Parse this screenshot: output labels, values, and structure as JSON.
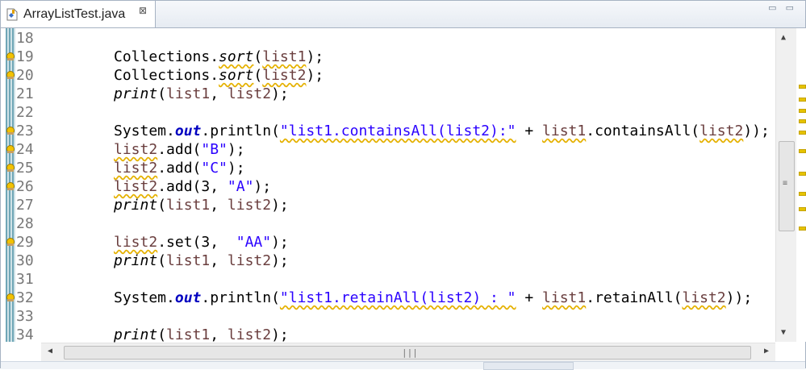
{
  "tab": {
    "filename": "ArrayListTest.java",
    "close_glyph": "⊠"
  },
  "window_buttons": "▭ ▭",
  "lines": [
    {
      "n": "18",
      "warn": false,
      "code": []
    },
    {
      "n": "19",
      "warn": true,
      "code": [
        [
          "Collections.",
          ""
        ],
        [
          "sort",
          "it"
        ],
        [
          "(",
          ""
        ],
        [
          "list1",
          "var"
        ],
        [
          ");",
          ""
        ]
      ]
    },
    {
      "n": "20",
      "warn": true,
      "code": [
        [
          "Collections.",
          ""
        ],
        [
          "sort",
          "it"
        ],
        [
          "(",
          ""
        ],
        [
          "list2",
          "var"
        ],
        [
          ");",
          ""
        ]
      ]
    },
    {
      "n": "21",
      "warn": false,
      "code": [
        [
          "print",
          "it"
        ],
        [
          "(",
          ""
        ],
        [
          "list1",
          "var"
        ],
        [
          ", ",
          ""
        ],
        [
          "list2",
          "var"
        ],
        [
          ");",
          ""
        ]
      ]
    },
    {
      "n": "22",
      "warn": false,
      "code": []
    },
    {
      "n": "23",
      "warn": true,
      "code": [
        [
          "System.",
          ""
        ],
        [
          "out",
          "fld"
        ],
        [
          ".println(",
          ""
        ],
        [
          "\"list1.containsAll(list2):\"",
          "str"
        ],
        [
          " + ",
          ""
        ],
        [
          "list1",
          "var"
        ],
        [
          ".containsAll(",
          ""
        ],
        [
          "list2",
          "var"
        ],
        [
          "));",
          ""
        ]
      ]
    },
    {
      "n": "24",
      "warn": true,
      "code": [
        [
          "list2",
          "var"
        ],
        [
          ".add(",
          ""
        ],
        [
          "\"B\"",
          "str"
        ],
        [
          ");",
          ""
        ]
      ]
    },
    {
      "n": "25",
      "warn": true,
      "code": [
        [
          "list2",
          "var"
        ],
        [
          ".add(",
          ""
        ],
        [
          "\"C\"",
          "str"
        ],
        [
          ");",
          ""
        ]
      ]
    },
    {
      "n": "26",
      "warn": true,
      "code": [
        [
          "list2",
          "var"
        ],
        [
          ".add(3, ",
          ""
        ],
        [
          "\"A\"",
          "str"
        ],
        [
          ");",
          ""
        ]
      ]
    },
    {
      "n": "27",
      "warn": false,
      "code": [
        [
          "print",
          "it"
        ],
        [
          "(",
          ""
        ],
        [
          "list1",
          "var"
        ],
        [
          ", ",
          ""
        ],
        [
          "list2",
          "var"
        ],
        [
          ");",
          ""
        ]
      ]
    },
    {
      "n": "28",
      "warn": false,
      "code": []
    },
    {
      "n": "29",
      "warn": true,
      "code": [
        [
          "list2",
          "var"
        ],
        [
          ".set(3,  ",
          ""
        ],
        [
          "\"AA\"",
          "str"
        ],
        [
          ");",
          ""
        ]
      ]
    },
    {
      "n": "30",
      "warn": false,
      "code": [
        [
          "print",
          "it"
        ],
        [
          "(",
          ""
        ],
        [
          "list1",
          "var"
        ],
        [
          ", ",
          ""
        ],
        [
          "list2",
          "var"
        ],
        [
          ");",
          ""
        ]
      ]
    },
    {
      "n": "31",
      "warn": false,
      "code": []
    },
    {
      "n": "32",
      "warn": true,
      "code": [
        [
          "System.",
          ""
        ],
        [
          "out",
          "fld"
        ],
        [
          ".println(",
          ""
        ],
        [
          "\"list1.retainAll(list2) : \"",
          "str"
        ],
        [
          " + ",
          ""
        ],
        [
          "list1",
          "var"
        ],
        [
          ".retainAll(",
          ""
        ],
        [
          "list2",
          "var"
        ],
        [
          "));",
          ""
        ]
      ]
    },
    {
      "n": "33",
      "warn": false,
      "code": []
    },
    {
      "n": "34",
      "warn": false,
      "code": [
        [
          "print",
          "it"
        ],
        [
          "(",
          ""
        ],
        [
          "list1",
          "var"
        ],
        [
          ", ",
          ""
        ],
        [
          "list2",
          "var"
        ],
        [
          ");",
          ""
        ]
      ]
    }
  ],
  "icons": {
    "file": "java-file-icon",
    "warning": "warning-marker-icon",
    "scroll_up": "scroll-up-arrow-icon",
    "scroll_down": "scroll-down-arrow-icon",
    "scroll_left": "scroll-left-arrow-icon",
    "scroll_right": "scroll-right-arrow-icon"
  },
  "colors": {
    "string": "#2a00ff",
    "field": "#0000c0",
    "local_var": "#6a3e3e",
    "warning": "#e5b100",
    "line_number": "#787878"
  }
}
